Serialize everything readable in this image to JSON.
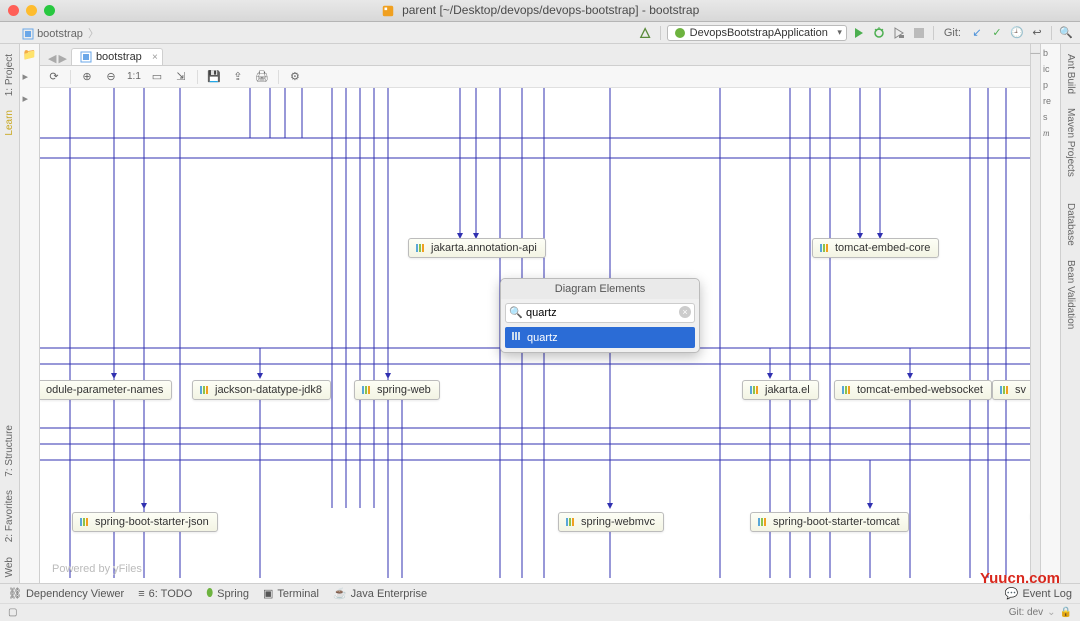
{
  "window": {
    "title": "parent [~/Desktop/devops/devops-bootstrap] - bootstrap"
  },
  "breadcrumb": {
    "item1": "bootstrap",
    "sep": "〉"
  },
  "toolbar": {
    "run_config": "DevopsBootstrapApplication",
    "git_label": "Git:"
  },
  "left_tabs": {
    "project": "1: Project",
    "learn": "Learn",
    "structure": "7: Structure",
    "favorites": "2: Favorites",
    "web": "Web"
  },
  "right_tabs": {
    "ant": "Ant Build",
    "maven": "Maven Projects",
    "database": "Database",
    "bean": "Bean Validation"
  },
  "right_mini": [
    "b",
    "ic",
    "p",
    "re",
    "s"
  ],
  "editor_tab": {
    "label": "bootstrap"
  },
  "diagram_toolbar": {
    "zoom_label": "1:1"
  },
  "nodes": {
    "jakarta_annotation": "jakarta.annotation-api",
    "tomcat_core": "tomcat-embed-core",
    "module_param": "odule-parameter-names",
    "jackson_jdk8": "jackson-datatype-jdk8",
    "spring_web": "spring-web",
    "jakarta_el": "jakarta.el",
    "tomcat_ws": "tomcat-embed-websocket",
    "sw_partial": "sv",
    "starter_json": "spring-boot-starter-json",
    "spring_webmvc": "spring-webmvc",
    "starter_tomcat": "spring-boot-starter-tomcat"
  },
  "popup": {
    "title": "Diagram Elements",
    "search_value": "quartz",
    "result": "quartz"
  },
  "bottom": {
    "dependency": "Dependency Viewer",
    "todo": "6: TODO",
    "spring": "Spring",
    "terminal": "Terminal",
    "java_ee": "Java Enterprise",
    "event_log": "Event Log"
  },
  "status": {
    "git_branch": "Git: dev",
    "lock": "🔒"
  },
  "canvas": {
    "yfiles": "Powered by yFiles"
  },
  "watermark": "Yuucn.com"
}
